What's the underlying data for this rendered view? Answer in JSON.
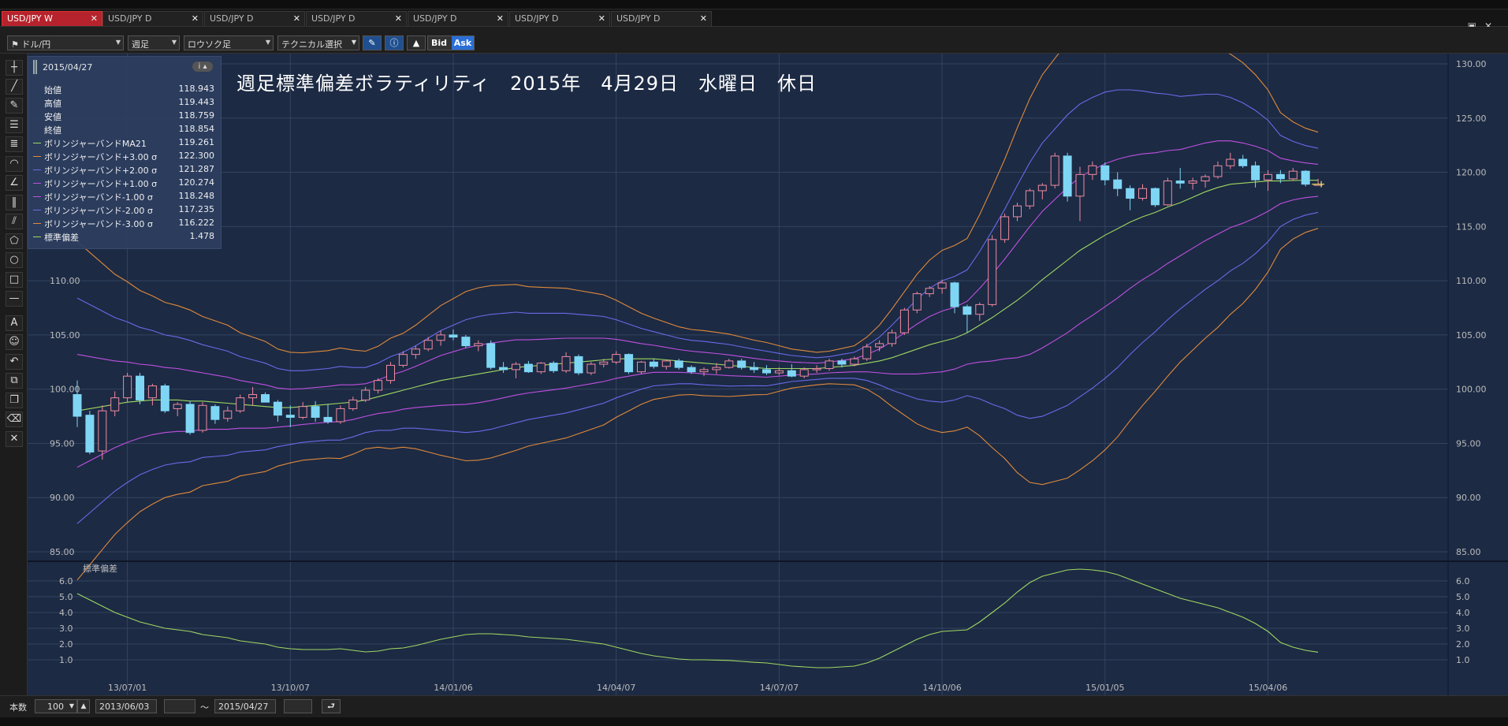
{
  "tabs": [
    {
      "label": "USD/JPY W",
      "active": true
    },
    {
      "label": "USD/JPY D",
      "active": false
    },
    {
      "label": "USD/JPY D",
      "active": false
    },
    {
      "label": "USD/JPY D",
      "active": false
    },
    {
      "label": "USD/JPY D",
      "active": false
    },
    {
      "label": "USD/JPY D",
      "active": false
    },
    {
      "label": "USD/JPY D",
      "active": false
    }
  ],
  "toolbar": {
    "pair": "ドル/円",
    "period": "週足",
    "chart_type": "ロウソク足",
    "technical": "テクニカル選択",
    "bid": "Bid",
    "ask": "Ask"
  },
  "legend": {
    "date": "2015/04/27",
    "ohlc": [
      {
        "name": "始値",
        "value": "118.943"
      },
      {
        "name": "高値",
        "value": "119.443"
      },
      {
        "name": "安値",
        "value": "118.759"
      },
      {
        "name": "終値",
        "value": "118.854"
      }
    ],
    "indicators": [
      {
        "name": "ボリンジャーバンドMA21",
        "value": "119.261",
        "color": "#9fd860"
      },
      {
        "name": "ボリンジャーバンド+3.00 σ",
        "value": "122.300",
        "color": "#e08a3a"
      },
      {
        "name": "ボリンジャーバンド+2.00 σ",
        "value": "121.287",
        "color": "#6a6ae8"
      },
      {
        "name": "ボリンジャーバンド+1.00 σ",
        "value": "120.274",
        "color": "#c050e0"
      },
      {
        "name": "ボリンジャーバンド-1.00 σ",
        "value": "118.248",
        "color": "#c050e0"
      },
      {
        "name": "ボリンジャーバンド-2.00 σ",
        "value": "117.235",
        "color": "#6a6ae8"
      },
      {
        "name": "ボリンジャーバンド-3.00 σ",
        "value": "116.222",
        "color": "#e08a3a"
      },
      {
        "name": "標準偏差",
        "value": "1.478",
        "color": "#9fd860"
      }
    ]
  },
  "chart_title": "週足標準偏差ボラティリティ　2015年　4月29日　水曜日　休日",
  "sub_panel_label": "標準偏差",
  "bottom": {
    "count_label": "本数",
    "count_value": "100",
    "from_date": "2013/06/03",
    "tilde": "〜",
    "to_date": "2015/04/27"
  },
  "colors": {
    "bg": "#1c2a44",
    "up": "#f08aa0",
    "down": "#7fd6f4",
    "ma": "#9fd860",
    "s3": "#e08a3a",
    "s2": "#6a6ae8",
    "s1": "#c050e0",
    "grid": "#34445e"
  },
  "chart_data": [
    {
      "type": "candlestick",
      "title": "週足標準偏差ボラティリティ　2015年　4月29日　水曜日　休日",
      "ylim": [
        85,
        130
      ],
      "y_ticks": [
        "130.00",
        "125.00",
        "120.00",
        "115.00",
        "110.00",
        "105.00",
        "100.00",
        "95.00",
        "90.00",
        "85.00"
      ],
      "x_ticks": [
        "13/07/01",
        "13/10/07",
        "14/01/06",
        "14/04/07",
        "14/07/07",
        "14/10/06",
        "15/01/05",
        "15/04/06"
      ],
      "x_tick_index": [
        4,
        17,
        30,
        43,
        56,
        69,
        82,
        95
      ],
      "ohlc": [
        [
          99.5,
          100.8,
          96.5,
          97.5
        ],
        [
          97.6,
          98.0,
          94.0,
          94.2
        ],
        [
          94.3,
          98.5,
          93.5,
          98.0
        ],
        [
          98.0,
          99.8,
          97.5,
          99.2
        ],
        [
          99.2,
          101.5,
          98.8,
          101.2
        ],
        [
          101.2,
          101.5,
          98.6,
          99.0
        ],
        [
          99.2,
          100.5,
          98.5,
          100.3
        ],
        [
          100.3,
          100.5,
          97.8,
          98.0
        ],
        [
          98.2,
          98.8,
          97.5,
          98.6
        ],
        [
          98.6,
          98.9,
          95.8,
          96.0
        ],
        [
          96.2,
          98.8,
          96.0,
          98.5
        ],
        [
          98.4,
          98.6,
          96.8,
          97.2
        ],
        [
          97.3,
          98.4,
          97.0,
          98.0
        ],
        [
          98.0,
          99.5,
          97.8,
          99.2
        ],
        [
          99.2,
          100.2,
          98.5,
          99.5
        ],
        [
          99.5,
          99.7,
          98.8,
          98.8
        ],
        [
          98.8,
          99.0,
          97.0,
          97.6
        ],
        [
          97.6,
          98.5,
          96.5,
          97.4
        ],
        [
          97.4,
          98.8,
          97.2,
          98.4
        ],
        [
          98.4,
          98.9,
          97.0,
          97.4
        ],
        [
          97.4,
          98.6,
          96.8,
          97.0
        ],
        [
          97.0,
          98.5,
          96.8,
          98.2
        ],
        [
          98.2,
          99.3,
          98.0,
          99.0
        ],
        [
          99.0,
          100.2,
          98.8,
          99.9
        ],
        [
          99.9,
          101.0,
          99.6,
          100.8
        ],
        [
          100.8,
          102.5,
          100.5,
          102.2
        ],
        [
          102.2,
          103.5,
          102.0,
          103.2
        ],
        [
          103.2,
          104.0,
          102.8,
          103.7
        ],
        [
          103.7,
          104.8,
          103.5,
          104.5
        ],
        [
          104.5,
          105.4,
          104.0,
          105.0
        ],
        [
          105.0,
          105.5,
          104.5,
          104.8
        ],
        [
          104.8,
          105.0,
          103.8,
          104.0
        ],
        [
          104.0,
          104.5,
          103.5,
          104.2
        ],
        [
          104.2,
          104.5,
          101.8,
          102.0
        ],
        [
          102.0,
          102.5,
          101.5,
          101.8
        ],
        [
          101.8,
          102.5,
          101.0,
          102.3
        ],
        [
          102.3,
          102.6,
          101.5,
          101.6
        ],
        [
          101.6,
          102.5,
          101.4,
          102.4
        ],
        [
          102.4,
          102.6,
          101.5,
          101.7
        ],
        [
          101.7,
          103.4,
          101.5,
          103.0
        ],
        [
          103.0,
          103.2,
          101.3,
          101.5
        ],
        [
          101.5,
          102.5,
          101.3,
          102.3
        ],
        [
          102.3,
          102.8,
          102.0,
          102.5
        ],
        [
          102.5,
          103.5,
          102.3,
          103.2
        ],
        [
          103.2,
          103.3,
          101.4,
          101.6
        ],
        [
          101.6,
          102.6,
          101.4,
          102.5
        ],
        [
          102.5,
          102.8,
          101.9,
          102.1
        ],
        [
          102.1,
          102.7,
          101.8,
          102.6
        ],
        [
          102.6,
          102.8,
          101.8,
          102.0
        ],
        [
          102.0,
          102.2,
          101.4,
          101.6
        ],
        [
          101.6,
          102.0,
          101.2,
          101.8
        ],
        [
          101.8,
          102.4,
          101.4,
          102.0
        ],
        [
          102.0,
          102.8,
          101.9,
          102.6
        ],
        [
          102.6,
          102.8,
          101.8,
          102.0
        ],
        [
          102.0,
          102.5,
          101.5,
          101.8
        ],
        [
          101.8,
          102.2,
          101.3,
          101.5
        ],
        [
          101.5,
          102.0,
          101.3,
          101.7
        ],
        [
          101.7,
          102.3,
          101.1,
          101.2
        ],
        [
          101.2,
          102.0,
          101.0,
          101.8
        ],
        [
          101.8,
          102.2,
          101.5,
          101.9
        ],
        [
          101.9,
          102.8,
          101.7,
          102.6
        ],
        [
          102.6,
          102.8,
          102.0,
          102.3
        ],
        [
          102.3,
          103.0,
          102.1,
          102.8
        ],
        [
          102.8,
          104.2,
          102.6,
          103.9
        ],
        [
          103.9,
          104.5,
          103.5,
          104.2
        ],
        [
          104.2,
          105.5,
          103.9,
          105.2
        ],
        [
          105.2,
          107.5,
          105.0,
          107.3
        ],
        [
          107.3,
          109.0,
          107.0,
          108.8
        ],
        [
          108.8,
          109.5,
          108.5,
          109.3
        ],
        [
          109.3,
          110.1,
          108.8,
          109.8
        ],
        [
          109.8,
          109.9,
          107.0,
          107.6
        ],
        [
          107.6,
          107.8,
          105.2,
          106.9
        ],
        [
          106.9,
          108.0,
          106.3,
          107.8
        ],
        [
          107.8,
          114.2,
          107.6,
          113.8
        ],
        [
          113.8,
          116.2,
          113.5,
          115.9
        ],
        [
          115.9,
          117.2,
          115.5,
          116.9
        ],
        [
          116.9,
          118.5,
          116.6,
          118.3
        ],
        [
          118.3,
          119.0,
          117.5,
          118.8
        ],
        [
          118.8,
          121.8,
          118.5,
          121.5
        ],
        [
          121.5,
          121.8,
          117.3,
          117.8
        ],
        [
          117.8,
          120.5,
          115.5,
          119.8
        ],
        [
          119.8,
          121.0,
          119.3,
          120.6
        ],
        [
          120.6,
          120.9,
          118.8,
          119.3
        ],
        [
          119.3,
          120.0,
          117.8,
          118.5
        ],
        [
          118.5,
          118.8,
          116.5,
          117.6
        ],
        [
          117.6,
          118.9,
          117.4,
          118.5
        ],
        [
          118.5,
          118.6,
          116.8,
          117.0
        ],
        [
          117.0,
          119.5,
          116.9,
          119.2
        ],
        [
          119.2,
          120.4,
          118.5,
          119.0
        ],
        [
          119.0,
          119.5,
          118.4,
          119.2
        ],
        [
          119.2,
          119.8,
          118.6,
          119.6
        ],
        [
          119.6,
          121.0,
          119.4,
          120.6
        ],
        [
          120.6,
          121.8,
          120.3,
          121.2
        ],
        [
          121.2,
          121.6,
          120.4,
          120.6
        ],
        [
          120.6,
          121.0,
          118.6,
          119.3
        ],
        [
          119.3,
          120.2,
          118.3,
          119.8
        ],
        [
          119.8,
          120.2,
          119.0,
          119.4
        ],
        [
          119.4,
          120.4,
          119.2,
          120.1
        ],
        [
          120.1,
          120.2,
          118.7,
          118.9
        ],
        [
          118.9,
          119.4,
          118.8,
          118.9
        ]
      ],
      "bollinger": {
        "ma": [
          98.0,
          98.2,
          98.4,
          98.6,
          98.8,
          98.9,
          99.0,
          99.0,
          99.0,
          98.9,
          98.9,
          98.8,
          98.7,
          98.6,
          98.5,
          98.4,
          98.3,
          98.3,
          98.4,
          98.5,
          98.6,
          98.7,
          98.8,
          99.0,
          99.3,
          99.6,
          99.9,
          100.2,
          100.5,
          100.8,
          101.0,
          101.2,
          101.4,
          101.6,
          101.8,
          102.0,
          102.1,
          102.2,
          102.3,
          102.4,
          102.5,
          102.6,
          102.7,
          102.8,
          102.8,
          102.8,
          102.8,
          102.7,
          102.6,
          102.5,
          102.4,
          102.3,
          102.2,
          102.1,
          102.0,
          101.9,
          101.9,
          101.9,
          101.9,
          101.9,
          102.0,
          102.1,
          102.2,
          102.4,
          102.6,
          102.9,
          103.3,
          103.7,
          104.1,
          104.4,
          104.7,
          105.2,
          105.9,
          106.6,
          107.4,
          108.2,
          109.1,
          110.1,
          111.0,
          111.9,
          112.8,
          113.5,
          114.2,
          114.8,
          115.4,
          115.9,
          116.3,
          116.8,
          117.2,
          117.7,
          118.2,
          118.6,
          118.9,
          119.0,
          119.1,
          119.2,
          119.2,
          119.25,
          119.26,
          119.26
        ],
        "sd": [
          5.2,
          4.8,
          4.4,
          4.0,
          3.7,
          3.4,
          3.2,
          3.0,
          2.9,
          2.8,
          2.6,
          2.5,
          2.4,
          2.2,
          2.1,
          2.0,
          1.8,
          1.7,
          1.65,
          1.65,
          1.65,
          1.7,
          1.6,
          1.5,
          1.55,
          1.7,
          1.75,
          1.9,
          2.1,
          2.3,
          2.45,
          2.6,
          2.65,
          2.65,
          2.6,
          2.55,
          2.45,
          2.4,
          2.35,
          2.3,
          2.2,
          2.1,
          2.0,
          1.8,
          1.6,
          1.4,
          1.25,
          1.15,
          1.05,
          1.0,
          1.0,
          0.98,
          0.96,
          0.9,
          0.84,
          0.8,
          0.7,
          0.6,
          0.55,
          0.5,
          0.5,
          0.55,
          0.6,
          0.8,
          1.1,
          1.5,
          1.9,
          2.3,
          2.6,
          2.8,
          2.85,
          2.9,
          3.4,
          4.0,
          4.6,
          5.3,
          5.9,
          6.3,
          6.5,
          6.7,
          6.75,
          6.7,
          6.6,
          6.4,
          6.1,
          5.8,
          5.5,
          5.2,
          4.9,
          4.7,
          4.5,
          4.3,
          4.0,
          3.7,
          3.3,
          2.8,
          2.1,
          1.8,
          1.6,
          1.478
        ]
      }
    },
    {
      "type": "line",
      "title": "標準偏差",
      "ylim": [
        0.4,
        6.8
      ],
      "y_ticks": [
        "6.0",
        "5.0",
        "4.0",
        "3.0",
        "2.0",
        "1.0"
      ],
      "series": "same as bollinger.sd"
    }
  ]
}
